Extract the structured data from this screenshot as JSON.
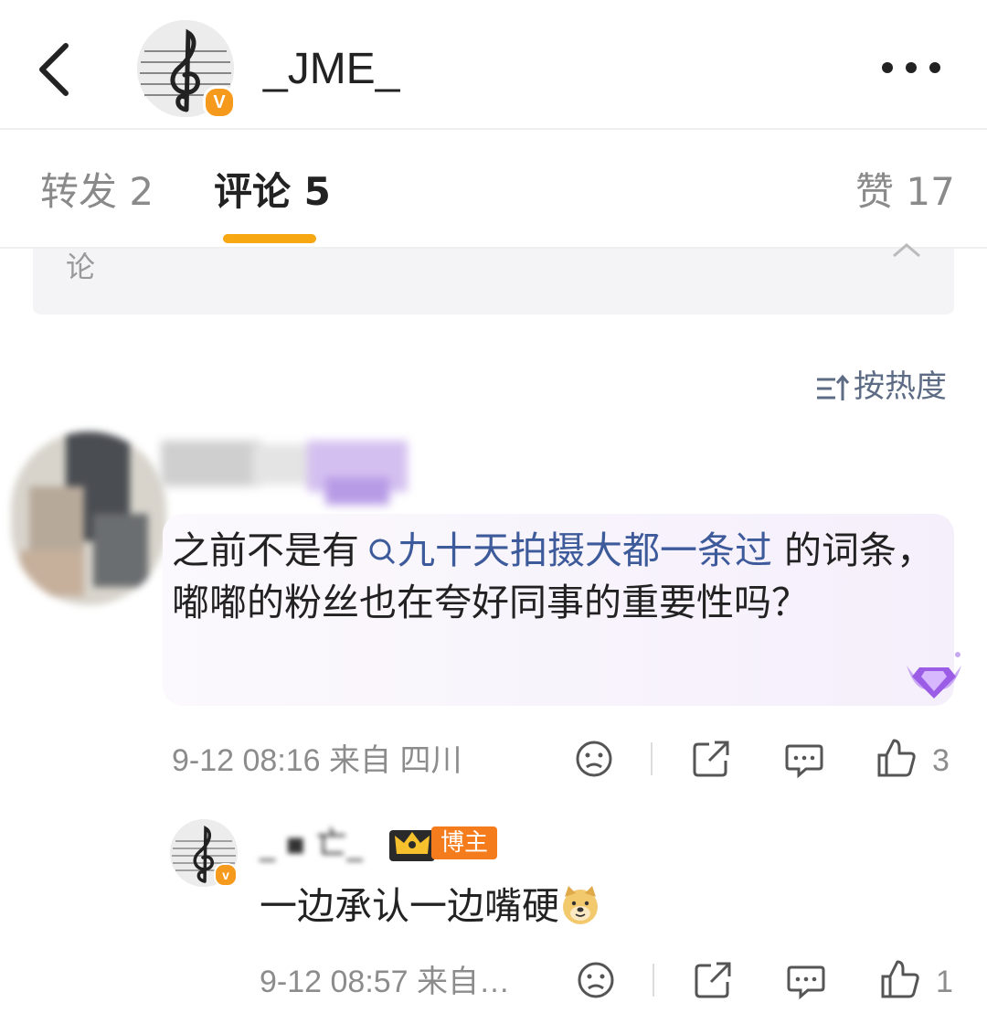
{
  "header": {
    "title": "_JME_",
    "avatar_badge": "V"
  },
  "tabs": [
    {
      "label": "转发 2"
    },
    {
      "label": "评论 5"
    },
    {
      "label": "赞 17"
    }
  ],
  "comment_box": {
    "partial_text": "论"
  },
  "sort": {
    "label": "按热度"
  },
  "comments": [
    {
      "text_before": "之前不是有",
      "topic": "九十天拍摄大都一条过",
      "text_after": " 的词条，嘟嘟的粉丝也在夸好同事的重要性吗？",
      "meta": "9-12 08:16  来自 四川",
      "likes": "3"
    },
    {
      "username": "_ ▪ 亡_",
      "owner_badge": "博主",
      "text": "一边承认一边嘴硬",
      "meta": "9-12 08:57  来自…",
      "likes": "1"
    }
  ],
  "colors": {
    "accent": "#f6a712",
    "topic": "#3d5a9a",
    "owner_badge": "#f47c1c",
    "verified": "#f59a1c"
  }
}
